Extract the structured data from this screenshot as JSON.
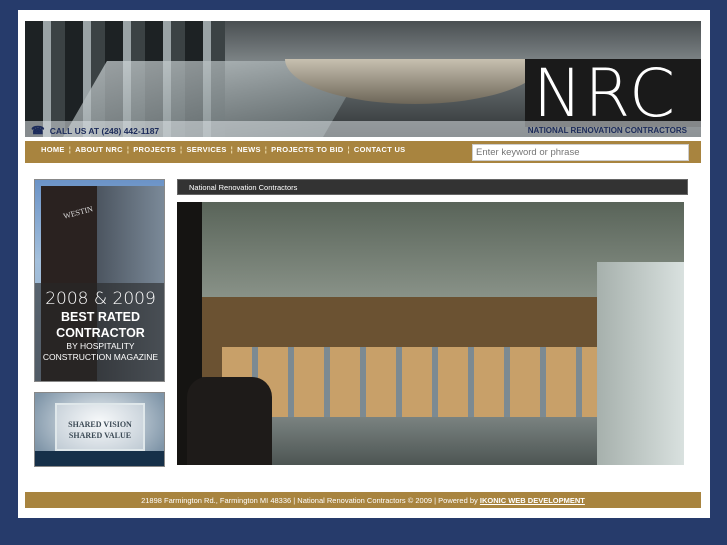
{
  "header": {
    "logo": "NRC",
    "call_label": "CALL US AT (248) 442-1187",
    "company_name": "NATIONAL RENOVATION CONTRACTORS"
  },
  "nav": {
    "items": [
      "HOME",
      "ABOUT NRC",
      "PROJECTS",
      "SERVICES",
      "NEWS",
      "PROJECTS TO BID",
      "CONTACT US"
    ],
    "search_placeholder": "Enter keyword or phrase"
  },
  "sidebar": {
    "award": {
      "sign": "WESTIN",
      "line1": "2008 & 2009",
      "line2": "BEST RATED",
      "line3": "CONTRACTOR",
      "line4": "BY HOSPITALITY",
      "line5": "CONSTRUCTION MAGAZINE"
    },
    "vision": {
      "line1": "SHARED VISION",
      "line2": "SHARED VALUE"
    }
  },
  "main": {
    "title": "National Renovation Contractors"
  },
  "footer": {
    "text": "21898 Farmington Rd., Farmington MI 48336 | National Renovation Contractors © 2009 | Powered by ",
    "link": "IKONIC WEB DEVELOPMENT"
  }
}
